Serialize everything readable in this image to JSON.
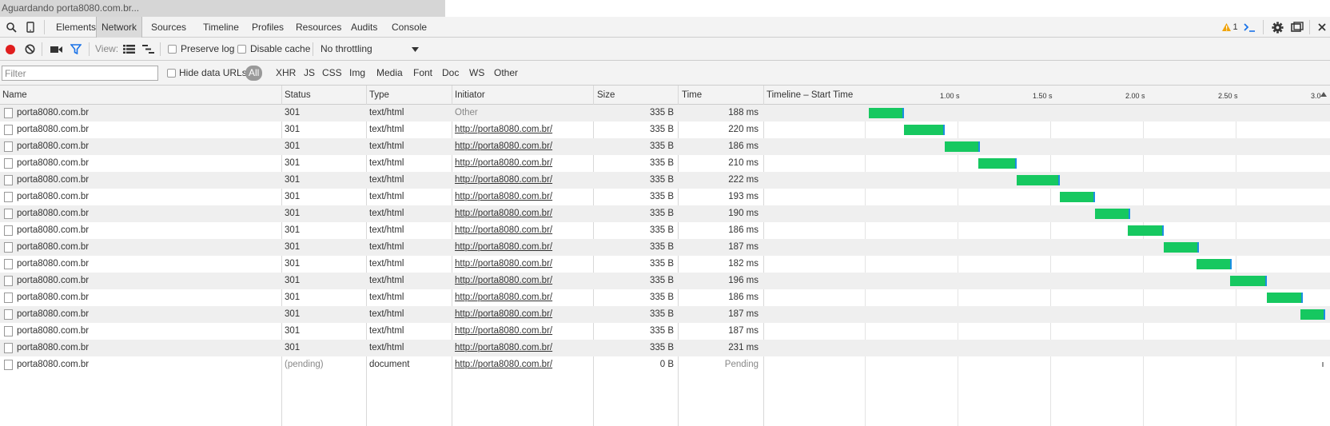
{
  "page_status": "Aguardando porta8080.com.br...",
  "tabs": [
    "Elements",
    "Network",
    "Sources",
    "Timeline",
    "Profiles",
    "Resources",
    "Audits",
    "Console"
  ],
  "active_tab": "Network",
  "warning_count": "1",
  "toolbar": {
    "view_label": "View:",
    "preserve_log": "Preserve log",
    "disable_cache": "Disable cache",
    "throttling": "No throttling"
  },
  "filter": {
    "placeholder": "Filter",
    "hide_data_urls": "Hide data URLs",
    "types": [
      "All",
      "XHR",
      "JS",
      "CSS",
      "Img",
      "Media",
      "Font",
      "Doc",
      "WS",
      "Other"
    ]
  },
  "columns": {
    "name": "Name",
    "status": "Status",
    "type": "Type",
    "initiator": "Initiator",
    "size": "Size",
    "time": "Time",
    "timeline": "Timeline – Start Time"
  },
  "timeline_ticks": [
    "1.00 s",
    "1.50 s",
    "2.00 s",
    "2.50 s",
    "3.0"
  ],
  "colors": {
    "bar": "#16c860",
    "bar_edge": "#1a8fe3",
    "record": "#e01e1e",
    "accent": "#1a73e8",
    "warning": "#f0a30a"
  },
  "requests": [
    {
      "name": "porta8080.com.br",
      "status": "301",
      "type": "text/html",
      "initiator": "Other",
      "initiator_link": false,
      "size": "335 B",
      "time": "188 ms",
      "start_s": 0.52,
      "end_s": 0.71
    },
    {
      "name": "porta8080.com.br",
      "status": "301",
      "type": "text/html",
      "initiator": "http://porta8080.com.br/",
      "initiator_link": true,
      "size": "335 B",
      "time": "220 ms",
      "start_s": 0.71,
      "end_s": 0.93
    },
    {
      "name": "porta8080.com.br",
      "status": "301",
      "type": "text/html",
      "initiator": "http://porta8080.com.br/",
      "initiator_link": true,
      "size": "335 B",
      "time": "186 ms",
      "start_s": 0.93,
      "end_s": 1.12
    },
    {
      "name": "porta8080.com.br",
      "status": "301",
      "type": "text/html",
      "initiator": "http://porta8080.com.br/",
      "initiator_link": true,
      "size": "335 B",
      "time": "210 ms",
      "start_s": 1.11,
      "end_s": 1.32
    },
    {
      "name": "porta8080.com.br",
      "status": "301",
      "type": "text/html",
      "initiator": "http://porta8080.com.br/",
      "initiator_link": true,
      "size": "335 B",
      "time": "222 ms",
      "start_s": 1.32,
      "end_s": 1.55
    },
    {
      "name": "porta8080.com.br",
      "status": "301",
      "type": "text/html",
      "initiator": "http://porta8080.com.br/",
      "initiator_link": true,
      "size": "335 B",
      "time": "193 ms",
      "start_s": 1.55,
      "end_s": 1.74
    },
    {
      "name": "porta8080.com.br",
      "status": "301",
      "type": "text/html",
      "initiator": "http://porta8080.com.br/",
      "initiator_link": true,
      "size": "335 B",
      "time": "190 ms",
      "start_s": 1.74,
      "end_s": 1.93
    },
    {
      "name": "porta8080.com.br",
      "status": "301",
      "type": "text/html",
      "initiator": "http://porta8080.com.br/",
      "initiator_link": true,
      "size": "335 B",
      "time": "186 ms",
      "start_s": 1.92,
      "end_s": 2.11
    },
    {
      "name": "porta8080.com.br",
      "status": "301",
      "type": "text/html",
      "initiator": "http://porta8080.com.br/",
      "initiator_link": true,
      "size": "335 B",
      "time": "187 ms",
      "start_s": 2.11,
      "end_s": 2.3
    },
    {
      "name": "porta8080.com.br",
      "status": "301",
      "type": "text/html",
      "initiator": "http://porta8080.com.br/",
      "initiator_link": true,
      "size": "335 B",
      "time": "182 ms",
      "start_s": 2.29,
      "end_s": 2.48
    },
    {
      "name": "porta8080.com.br",
      "status": "301",
      "type": "text/html",
      "initiator": "http://porta8080.com.br/",
      "initiator_link": true,
      "size": "335 B",
      "time": "196 ms",
      "start_s": 2.47,
      "end_s": 2.67
    },
    {
      "name": "porta8080.com.br",
      "status": "301",
      "type": "text/html",
      "initiator": "http://porta8080.com.br/",
      "initiator_link": true,
      "size": "335 B",
      "time": "186 ms",
      "start_s": 2.67,
      "end_s": 2.86
    },
    {
      "name": "porta8080.com.br",
      "status": "301",
      "type": "text/html",
      "initiator": "http://porta8080.com.br/",
      "initiator_link": true,
      "size": "335 B",
      "time": "187 ms",
      "start_s": 2.85,
      "end_s": 3.04
    },
    {
      "name": "porta8080.com.br",
      "status": "301",
      "type": "text/html",
      "initiator": "http://porta8080.com.br/",
      "initiator_link": true,
      "size": "335 B",
      "time": "187 ms",
      "start_s": 3.04,
      "end_s": 3.23
    },
    {
      "name": "porta8080.com.br",
      "status": "301",
      "type": "text/html",
      "initiator": "http://porta8080.com.br/",
      "initiator_link": true,
      "size": "335 B",
      "time": "231 ms",
      "start_s": 3.23,
      "end_s": 3.46
    },
    {
      "name": "porta8080.com.br",
      "status": "(pending)",
      "type": "document",
      "initiator": "http://porta8080.com.br/",
      "initiator_link": true,
      "size": "0 B",
      "time": "Pending",
      "start_s": 3.46,
      "end_s": null
    }
  ]
}
